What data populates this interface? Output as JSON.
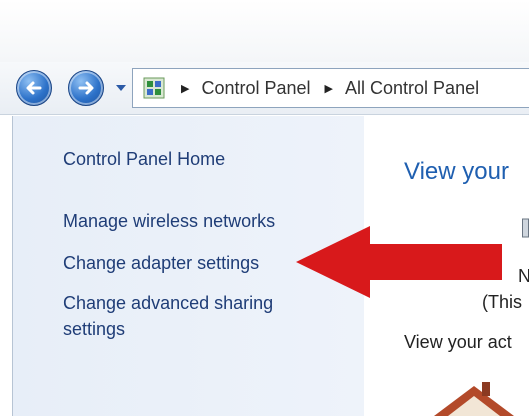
{
  "address_bar": {
    "crumbs": [
      "Control Panel",
      "All Control Panel"
    ]
  },
  "sidebar": {
    "home_label": "Control Panel Home",
    "links": [
      "Manage wireless networks",
      "Change adapter settings",
      "Change advanced sharing settings"
    ]
  },
  "main": {
    "title": "View your",
    "fragment_n": "N",
    "fragment_this": "(This",
    "view_active": "View your act"
  },
  "colors": {
    "link": "#1f3d77",
    "title": "#1f5fb0",
    "arrow": "#d8191b",
    "sidebar_bg": "#e7eef8"
  },
  "icons": [
    "back-arrow-icon",
    "forward-arrow-icon",
    "dropdown-arrow-icon",
    "control-panel-icon",
    "breadcrumb-separator-icon",
    "red-pointer-arrow",
    "house-icon"
  ]
}
